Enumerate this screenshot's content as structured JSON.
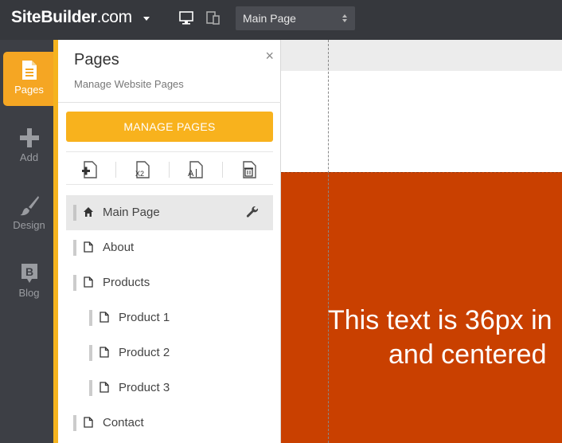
{
  "topbar": {
    "logo_bold": "SiteBuilder",
    "logo_domain": ".com",
    "page_select_value": "Main Page"
  },
  "rail": {
    "items": [
      {
        "label": "Pages",
        "icon": "page-icon",
        "active": true
      },
      {
        "label": "Add",
        "icon": "plus-icon",
        "active": false
      },
      {
        "label": "Design",
        "icon": "brush-icon",
        "active": false
      },
      {
        "label": "Blog",
        "icon": "blog-b-icon",
        "active": false
      }
    ]
  },
  "panel": {
    "title": "Pages",
    "subtitle": "Manage Website Pages",
    "close": "×",
    "manage_button": "MANAGE PAGES",
    "tools": [
      "add-page-icon",
      "duplicate-page-icon",
      "rename-page-icon",
      "delete-page-icon"
    ],
    "tool_x2_label": "X2",
    "tool_rename_label": "A",
    "pages": [
      {
        "label": "Main Page",
        "level": 0,
        "home": true,
        "active": true
      },
      {
        "label": "About",
        "level": 0
      },
      {
        "label": "Products",
        "level": 0
      },
      {
        "label": "Product 1",
        "level": 1
      },
      {
        "label": "Product 2",
        "level": 1
      },
      {
        "label": "Product 3",
        "level": 1
      },
      {
        "label": "Contact",
        "level": 0
      }
    ]
  },
  "canvas": {
    "hero_line1": "This text is 36px in",
    "hero_line2": "and centered"
  },
  "colors": {
    "accent": "#f5a623",
    "button": "#f8b21d",
    "hero": "#c94000",
    "topbar": "#36383d"
  }
}
